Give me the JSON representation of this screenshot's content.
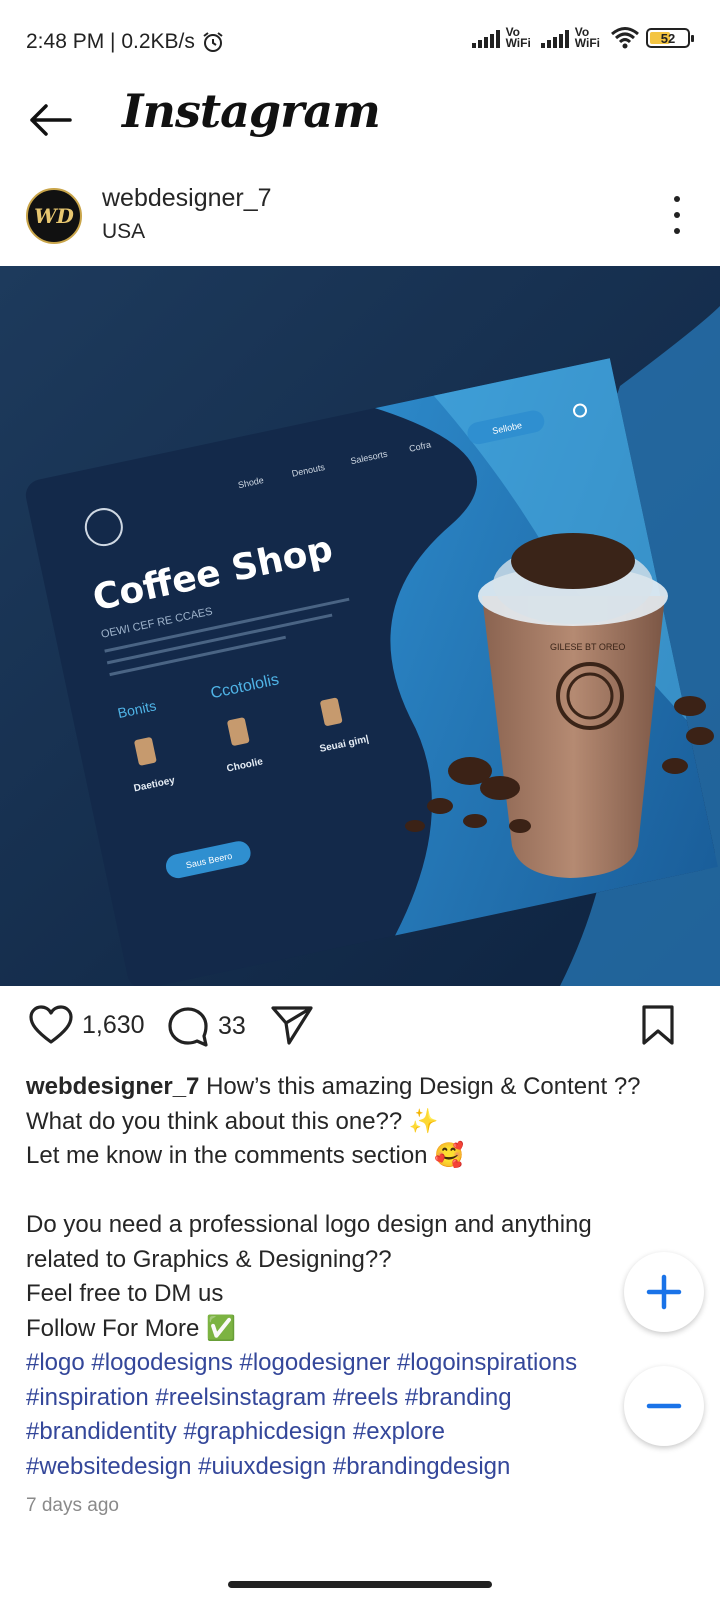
{
  "status_bar": {
    "time_speed": "2:48 PM | 0.2KB/s",
    "vowifi_1": "Vo\nWiFi",
    "vowifi_2": "Vo\nWiFi",
    "battery": "52"
  },
  "header": {
    "title": "Instagram"
  },
  "post": {
    "username": "webdesigner_7",
    "location": "USA",
    "likes": "1,630",
    "comments": "33",
    "time_ago": "7 days ago",
    "image": {
      "title": "Coffee Shop",
      "subtitle": "OEWI CEF RE CCAES",
      "nav": [
        "Shode",
        "Denouts",
        "Salesorts",
        "Cofra"
      ],
      "cta_top": "Sellobe",
      "section_left": "Bonits",
      "section_right": "Ccotololis",
      "items": [
        "Daetioey",
        "Choolie",
        "Seuai gim|"
      ],
      "cta_bottom": "Saus Beero",
      "cup_label": "GILESE BT OREO"
    }
  },
  "caption": {
    "username": "webdesigner_7",
    "line1_rest": " How’s this amazing Design & Content ??",
    "line2": "What do you think about this one?? ✨",
    "line3": "Let me know in the comments section 🥰",
    "line4": "Do you need a professional logo design and anything",
    "line5": "related to Graphics & Designing??",
    "line6": "Feel free to DM us",
    "line7": "Follow For More ✅",
    "tags1": "#logo #logodesigns #logodesigner #logoinspirations",
    "tags2": "#inspiration #reelsinstagram #reels #branding",
    "tags3": "#brandidentity #graphicdesign #explore",
    "tags4": "#websitedesign #uiuxdesign #brandingdesign"
  },
  "colors": {
    "hashtag": "#34479a",
    "zoom_icon": "#1a73e8",
    "battery_fill": "#f4c542"
  },
  "icons": {
    "back": "arrow-left-icon",
    "more": "more-vertical-icon",
    "like": "heart-icon",
    "comment": "comment-icon",
    "share": "send-icon",
    "save": "bookmark-icon",
    "zoom_in": "plus-icon",
    "zoom_out": "minus-icon"
  }
}
